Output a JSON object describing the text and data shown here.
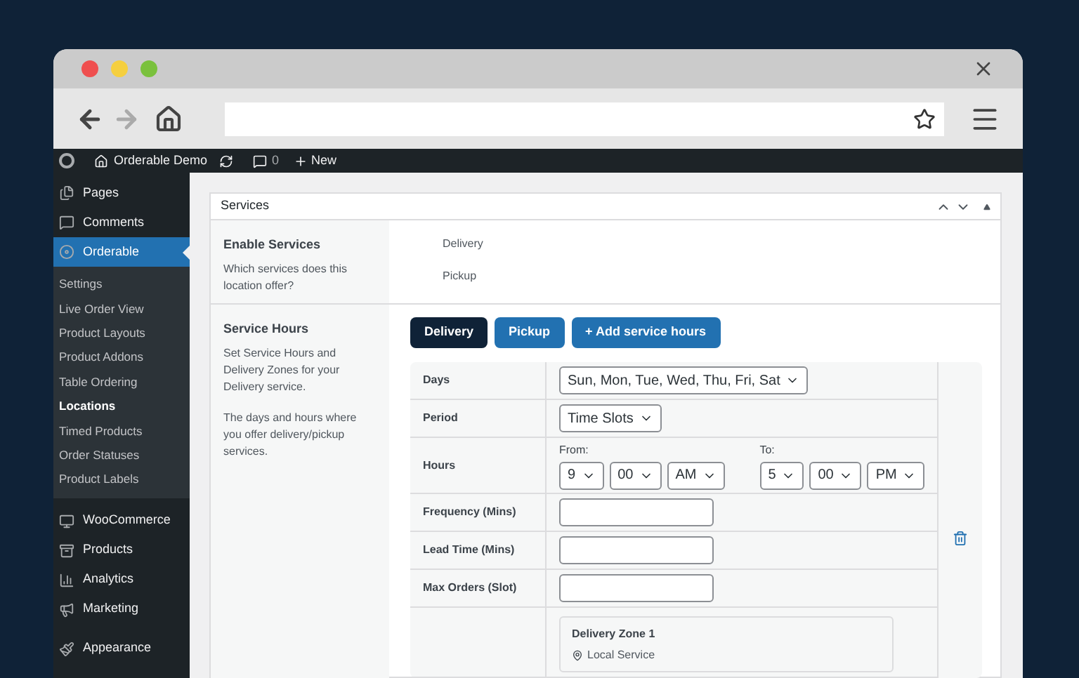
{
  "admin_bar": {
    "site_name": "Orderable Demo",
    "comments_count": "0",
    "new_label": "New"
  },
  "sidebar": {
    "items": [
      {
        "label": "Pages",
        "selected": false
      },
      {
        "label": "Comments",
        "selected": false
      },
      {
        "label": "Orderable",
        "selected": true,
        "children": [
          {
            "label": "Settings",
            "selected": false
          },
          {
            "label": "Live Order View",
            "selected": false
          },
          {
            "label": "Product Layouts",
            "selected": false
          },
          {
            "label": "Product Addons",
            "selected": false
          },
          {
            "label": "Table Ordering",
            "selected": false
          },
          {
            "label": "Locations",
            "selected": true
          },
          {
            "label": "Timed Products",
            "selected": false
          },
          {
            "label": "Order Statuses",
            "selected": false
          },
          {
            "label": "Product Labels",
            "selected": false
          }
        ]
      },
      {
        "label": "WooCommerce",
        "selected": false
      },
      {
        "label": "Products",
        "selected": false
      },
      {
        "label": "Analytics",
        "selected": false
      },
      {
        "label": "Marketing",
        "selected": false
      },
      {
        "label": "Appearance",
        "selected": false
      }
    ]
  },
  "panel": {
    "title": "Services",
    "enable_services": {
      "title": "Enable Services",
      "description": "Which services does this location offer?",
      "options": [
        "Delivery",
        "Pickup"
      ]
    },
    "service_hours": {
      "title": "Service Hours",
      "description": [
        "Set Service Hours and Delivery Zones for your Delivery service.",
        "The days and hours where you offer delivery/pickup services."
      ],
      "tabs": [
        {
          "label": "Delivery",
          "selected": true
        },
        {
          "label": "Pickup",
          "selected": false
        }
      ],
      "add_button": "+ Add service hours",
      "rows": [
        {
          "kind": "select",
          "label": "Days",
          "value": "Sun, Mon, Tue, Wed, Thu, Fri, Sat"
        },
        {
          "kind": "select",
          "label": "Period",
          "value": "Time Slots"
        },
        {
          "kind": "time",
          "label": "Hours",
          "from_label": "From:",
          "to_label": "To:",
          "from": [
            "9",
            "00",
            "AM"
          ],
          "to": [
            "5",
            "00",
            "PM"
          ]
        },
        {
          "kind": "input",
          "label": "Frequency (Mins)"
        },
        {
          "kind": "input",
          "label": "Lead Time (Mins)"
        },
        {
          "kind": "input",
          "label": "Max Orders (Slot)"
        },
        {
          "kind": "zone",
          "zone_title": "Delivery Zone 1",
          "zone_type": "Local Service"
        }
      ]
    }
  }
}
